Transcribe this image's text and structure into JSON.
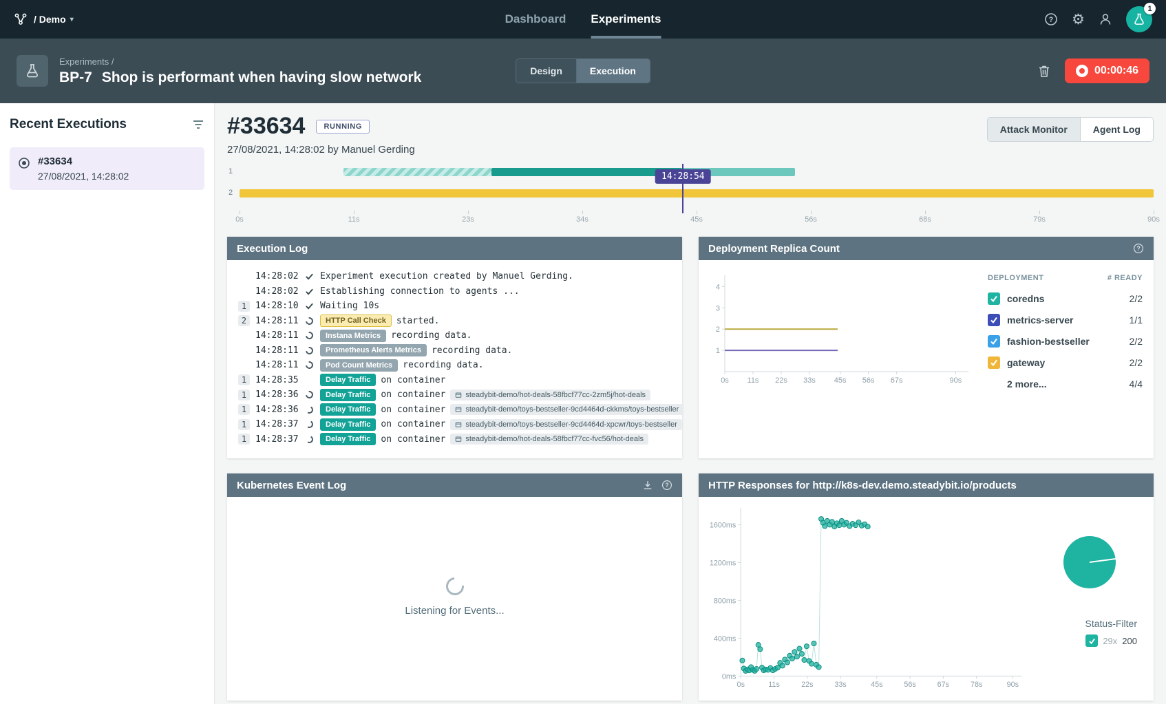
{
  "topnav": {
    "brand": "/ Demo",
    "tabs": [
      {
        "id": "dashboard",
        "label": "Dashboard",
        "active": false
      },
      {
        "id": "experiments",
        "label": "Experiments",
        "active": true
      }
    ],
    "avatar_badge": "1"
  },
  "icons": {
    "caret_down": "▾",
    "gear": "⚙"
  },
  "subheader": {
    "breadcrumb": "Experiments /",
    "experiment_key": "BP-7",
    "experiment_title": "Shop is performant when having slow network",
    "mode_toggle": [
      {
        "label": "Design",
        "active": false
      },
      {
        "label": "Execution",
        "active": true
      }
    ],
    "timer": "00:00:46"
  },
  "sidebar": {
    "title": "Recent Executions",
    "executions": [
      {
        "id": "#33634",
        "timestamp": "27/08/2021, 14:28:02",
        "selected": true
      }
    ]
  },
  "execution": {
    "id": "#33634",
    "status": "RUNNING",
    "meta": "27/08/2021, 14:28:02 by Manuel Gerding",
    "view_toggle": [
      {
        "label": "Attack Monitor",
        "active": true
      },
      {
        "label": "Agent Log",
        "active": false
      }
    ]
  },
  "timeline": {
    "xlim": [
      0,
      90
    ],
    "ticks": [
      {
        "v": 0,
        "label": "0s"
      },
      {
        "v": 11.25,
        "label": "11s"
      },
      {
        "v": 22.5,
        "label": "23s"
      },
      {
        "v": 33.75,
        "label": "34s"
      },
      {
        "v": 45,
        "label": "45s"
      },
      {
        "v": 56.25,
        "label": "56s"
      },
      {
        "v": 67.5,
        "label": "68s"
      },
      {
        "v": 78.75,
        "label": "79s"
      },
      {
        "v": 90,
        "label": "90s"
      }
    ],
    "cursor": {
      "v": 43.6,
      "label": "14:28:54"
    },
    "rows": [
      {
        "num": "1",
        "color": "teal",
        "segments": [
          {
            "from": 10.2,
            "to": 24.8,
            "style": "hatched"
          },
          {
            "from": 24.8,
            "to": 43.6,
            "style": "solid"
          },
          {
            "from": 43.6,
            "to": 54.7,
            "style": "dim"
          }
        ]
      },
      {
        "num": "2",
        "color": "yellow",
        "segments": [
          {
            "from": 0,
            "to": 90,
            "style": "solid"
          }
        ]
      }
    ]
  },
  "panels": {
    "execution_log": {
      "title": "Execution Log",
      "entries": [
        {
          "num": "",
          "time": "14:28:02",
          "icon": "check",
          "text": "Experiment execution created by Manuel Gerding."
        },
        {
          "num": "",
          "time": "14:28:02",
          "icon": "check",
          "text": "Establishing connection to agents ..."
        },
        {
          "num": "1",
          "time": "14:28:10",
          "icon": "check",
          "text": "Waiting 10s"
        },
        {
          "num": "2",
          "time": "14:28:11",
          "icon": "spin",
          "badge": {
            "label": "HTTP Call Check",
            "type": "yellow"
          },
          "text": "started."
        },
        {
          "num": "",
          "time": "14:28:11",
          "icon": "spin",
          "badge": {
            "label": "Instana Metrics",
            "type": "gray"
          },
          "text": "recording data."
        },
        {
          "num": "",
          "time": "14:28:11",
          "icon": "spin",
          "badge": {
            "label": "Prometheus Alerts Metrics",
            "type": "gray"
          },
          "text": "recording data."
        },
        {
          "num": "",
          "time": "14:28:11",
          "icon": "spin",
          "badge": {
            "label": "Pod Count Metrics",
            "type": "gray"
          },
          "text": "recording data."
        },
        {
          "num": "1",
          "time": "14:28:35",
          "icon": "",
          "badge": {
            "label": "Delay Traffic",
            "type": "teal"
          },
          "text": "on container"
        },
        {
          "num": "1",
          "time": "14:28:36",
          "icon": "spin",
          "badge": {
            "label": "Delay Traffic",
            "type": "teal"
          },
          "text": "on container",
          "chip": "steadybit-demo/hot-deals-58fbcf77cc-2zm5j/hot-deals"
        },
        {
          "num": "1",
          "time": "14:28:36",
          "icon": "load",
          "badge": {
            "label": "Delay Traffic",
            "type": "teal"
          },
          "text": "on container",
          "chip": "steadybit-demo/toys-bestseller-9cd4464d-ckkms/toys-bestseller"
        },
        {
          "num": "1",
          "time": "14:28:37",
          "icon": "load",
          "badge": {
            "label": "Delay Traffic",
            "type": "teal"
          },
          "text": "on container",
          "chip": "steadybit-demo/toys-bestseller-9cd4464d-xpcwr/toys-bestseller"
        },
        {
          "num": "1",
          "time": "14:28:37",
          "icon": "load",
          "badge": {
            "label": "Delay Traffic",
            "type": "teal"
          },
          "text": "on container",
          "chip": "steadybit-demo/hot-deals-58fbcf77cc-fvc56/hot-deals"
        }
      ]
    },
    "replica_count": {
      "title": "Deployment Replica Count",
      "chart_data": {
        "type": "line",
        "xlim": [
          0,
          95
        ],
        "ylim": [
          0,
          4.4
        ],
        "x_ticks": [
          {
            "v": 0,
            "label": "0s"
          },
          {
            "v": 11,
            "label": "11s"
          },
          {
            "v": 22,
            "label": "22s"
          },
          {
            "v": 33,
            "label": "33s"
          },
          {
            "v": 45,
            "label": "45s"
          },
          {
            "v": 56,
            "label": "56s"
          },
          {
            "v": 67,
            "label": "67s"
          },
          {
            "v": 90,
            "label": "90s"
          }
        ],
        "y_ticks": [
          {
            "v": 1,
            "label": "1"
          },
          {
            "v": 2,
            "label": "2"
          },
          {
            "v": 3,
            "label": "3"
          },
          {
            "v": 4,
            "label": "4"
          }
        ],
        "series": [
          {
            "name": "replicas-at-2",
            "color": "#b9a83c",
            "points": [
              [
                0,
                2
              ],
              [
                44,
                2
              ]
            ]
          },
          {
            "name": "replicas-at-1",
            "color": "#7568b8",
            "points": [
              [
                0,
                1
              ],
              [
                44,
                1
              ]
            ]
          }
        ]
      },
      "table": {
        "headers": [
          "DEPLOYMENT",
          "# READY"
        ],
        "rows": [
          {
            "name": "coredns",
            "ready": "2/2",
            "checkbox": "#1fb3a2"
          },
          {
            "name": "metrics-server",
            "ready": "1/1",
            "checkbox": "#3d4db7"
          },
          {
            "name": "fashion-bestseller",
            "ready": "2/2",
            "checkbox": "#3aa0e8"
          },
          {
            "name": "gateway",
            "ready": "2/2",
            "checkbox": "#f0b63a"
          },
          {
            "name": "2 more...",
            "ready": "4/4",
            "checkbox": null
          }
        ]
      }
    },
    "k8s_event_log": {
      "title": "Kubernetes Event Log",
      "empty_text": "Listening for Events..."
    },
    "http_responses": {
      "title": "HTTP Responses for http://k8s-dev.demo.steadybit.io/products",
      "chart_data": {
        "type": "scatter",
        "xlim": [
          0,
          93
        ],
        "ylim": [
          0,
          1750
        ],
        "x_ticks": [
          {
            "v": 0,
            "label": "0s"
          },
          {
            "v": 11,
            "label": "11s"
          },
          {
            "v": 22,
            "label": "22s"
          },
          {
            "v": 33,
            "label": "33s"
          },
          {
            "v": 45,
            "label": "45s"
          },
          {
            "v": 56,
            "label": "56s"
          },
          {
            "v": 67,
            "label": "67s"
          },
          {
            "v": 78,
            "label": "78s"
          },
          {
            "v": 90,
            "label": "90s"
          }
        ],
        "y_ticks": [
          {
            "v": 0,
            "label": "0ms"
          },
          {
            "v": 400,
            "label": "400ms"
          },
          {
            "v": 800,
            "label": "800ms"
          },
          {
            "v": 1200,
            "label": "1200ms"
          },
          {
            "v": 1600,
            "label": "1600ms"
          }
        ],
        "series": [
          {
            "name": "response-time",
            "color": "#1fb3a2",
            "stroke": "#0e8d80",
            "line_color": "#b9e2dc",
            "width": 1,
            "markers": true,
            "points": [
              [
                0.5,
                165
              ],
              [
                1,
                80
              ],
              [
                1.6,
                55
              ],
              [
                2.2,
                70
              ],
              [
                2.8,
                60
              ],
              [
                3.4,
                95
              ],
              [
                4,
                65
              ],
              [
                4.6,
                55
              ],
              [
                5.2,
                75
              ],
              [
                5.8,
                330
              ],
              [
                6.4,
                285
              ],
              [
                7,
                90
              ],
              [
                7.6,
                60
              ],
              [
                8.2,
                70
              ],
              [
                9,
                65
              ],
              [
                9.8,
                85
              ],
              [
                10.6,
                60
              ],
              [
                11.4,
                75
              ],
              [
                12.2,
                90
              ],
              [
                13,
                140
              ],
              [
                13.8,
                110
              ],
              [
                14.6,
                175
              ],
              [
                15.4,
                145
              ],
              [
                16.2,
                215
              ],
              [
                17,
                185
              ],
              [
                17.8,
                255
              ],
              [
                18.6,
                205
              ],
              [
                19.4,
                290
              ],
              [
                20.2,
                235
              ],
              [
                21,
                170
              ],
              [
                21.8,
                315
              ],
              [
                22.6,
                160
              ],
              [
                23.4,
                130
              ],
              [
                24.2,
                345
              ],
              [
                25,
                120
              ],
              [
                25.8,
                95
              ],
              [
                26.6,
                1660
              ],
              [
                27.2,
                1620
              ],
              [
                27.8,
                1585
              ],
              [
                28.6,
                1640
              ],
              [
                29.4,
                1600
              ],
              [
                30.2,
                1630
              ],
              [
                31,
                1580
              ],
              [
                31.8,
                1615
              ],
              [
                32.6,
                1595
              ],
              [
                33.4,
                1640
              ],
              [
                34.2,
                1600
              ],
              [
                35,
                1620
              ],
              [
                36,
                1585
              ],
              [
                37,
                1610
              ],
              [
                38,
                1595
              ],
              [
                39,
                1625
              ],
              [
                40,
                1590
              ],
              [
                41,
                1605
              ],
              [
                42,
                1580
              ]
            ]
          }
        ]
      },
      "status_filter": {
        "label": "Status-Filter",
        "count": "29x",
        "status": "200",
        "color": "#1fb3a2"
      }
    }
  }
}
